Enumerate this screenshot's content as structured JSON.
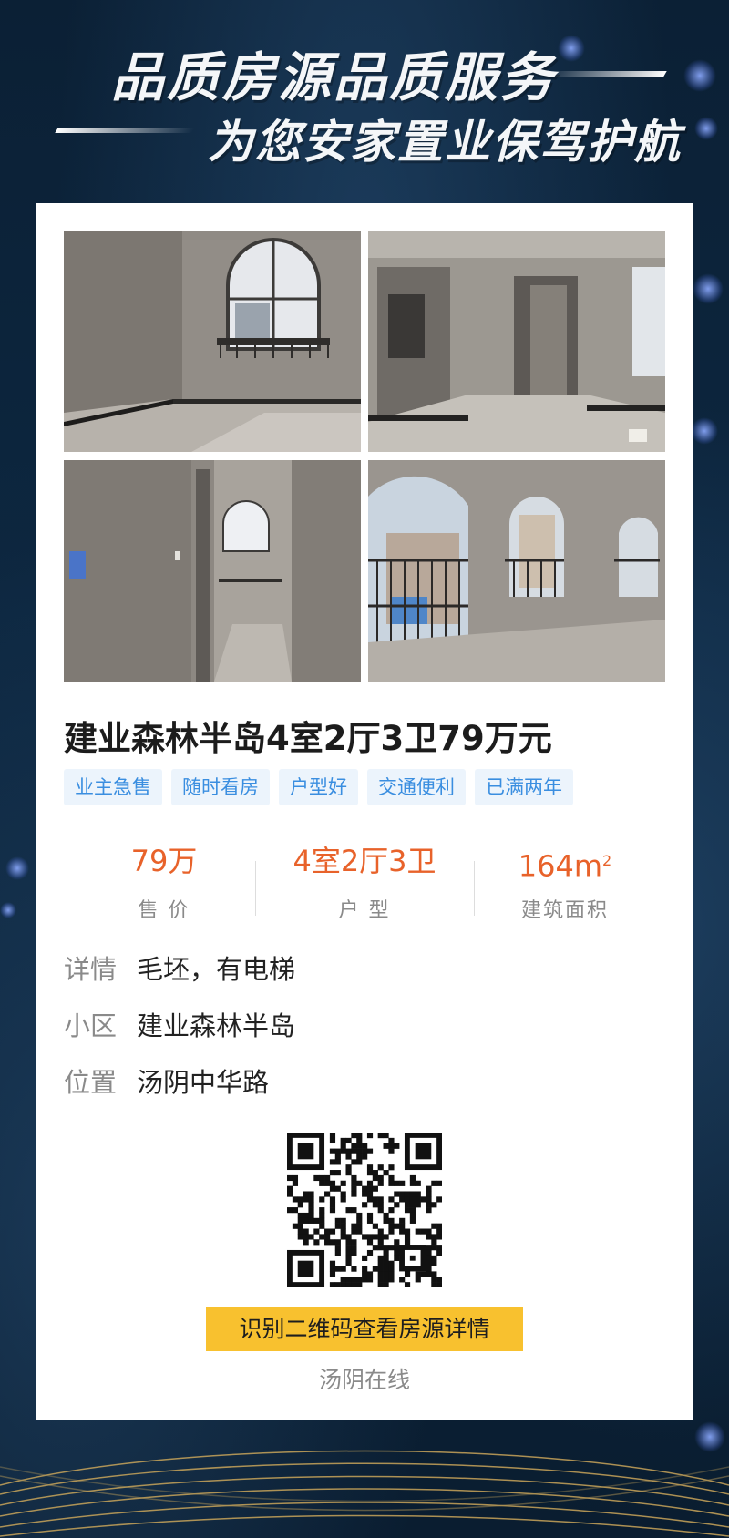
{
  "banner": {
    "headline": "品质房源品质服务",
    "subline": "为您安家置业保驾护航"
  },
  "listing": {
    "title": "建业森林半岛4室2厅3卫79万元",
    "tags": [
      "业主急售",
      "随时看房",
      "户型好",
      "交通便利",
      "已满两年"
    ],
    "stats": {
      "price": {
        "value": "79万",
        "label": "售 价"
      },
      "layout": {
        "value": "4室2厅3卫",
        "label": "户 型"
      },
      "area": {
        "value": "164m",
        "unit_sup": "2",
        "label": "建筑面积"
      }
    },
    "details": [
      {
        "key": "详情",
        "value": "毛坯，有电梯"
      },
      {
        "key": "小区",
        "value": "建业森林半岛"
      },
      {
        "key": "位置",
        "value": "汤阴中华路"
      }
    ]
  },
  "cta": {
    "label": "识别二维码查看房源详情"
  },
  "brand": {
    "name": "汤阴在线"
  },
  "icons": [
    "qr-code-icon"
  ],
  "colors": {
    "accent": "#e8622a",
    "tag_text": "#3a8ee0",
    "cta": "#f8c12f"
  }
}
